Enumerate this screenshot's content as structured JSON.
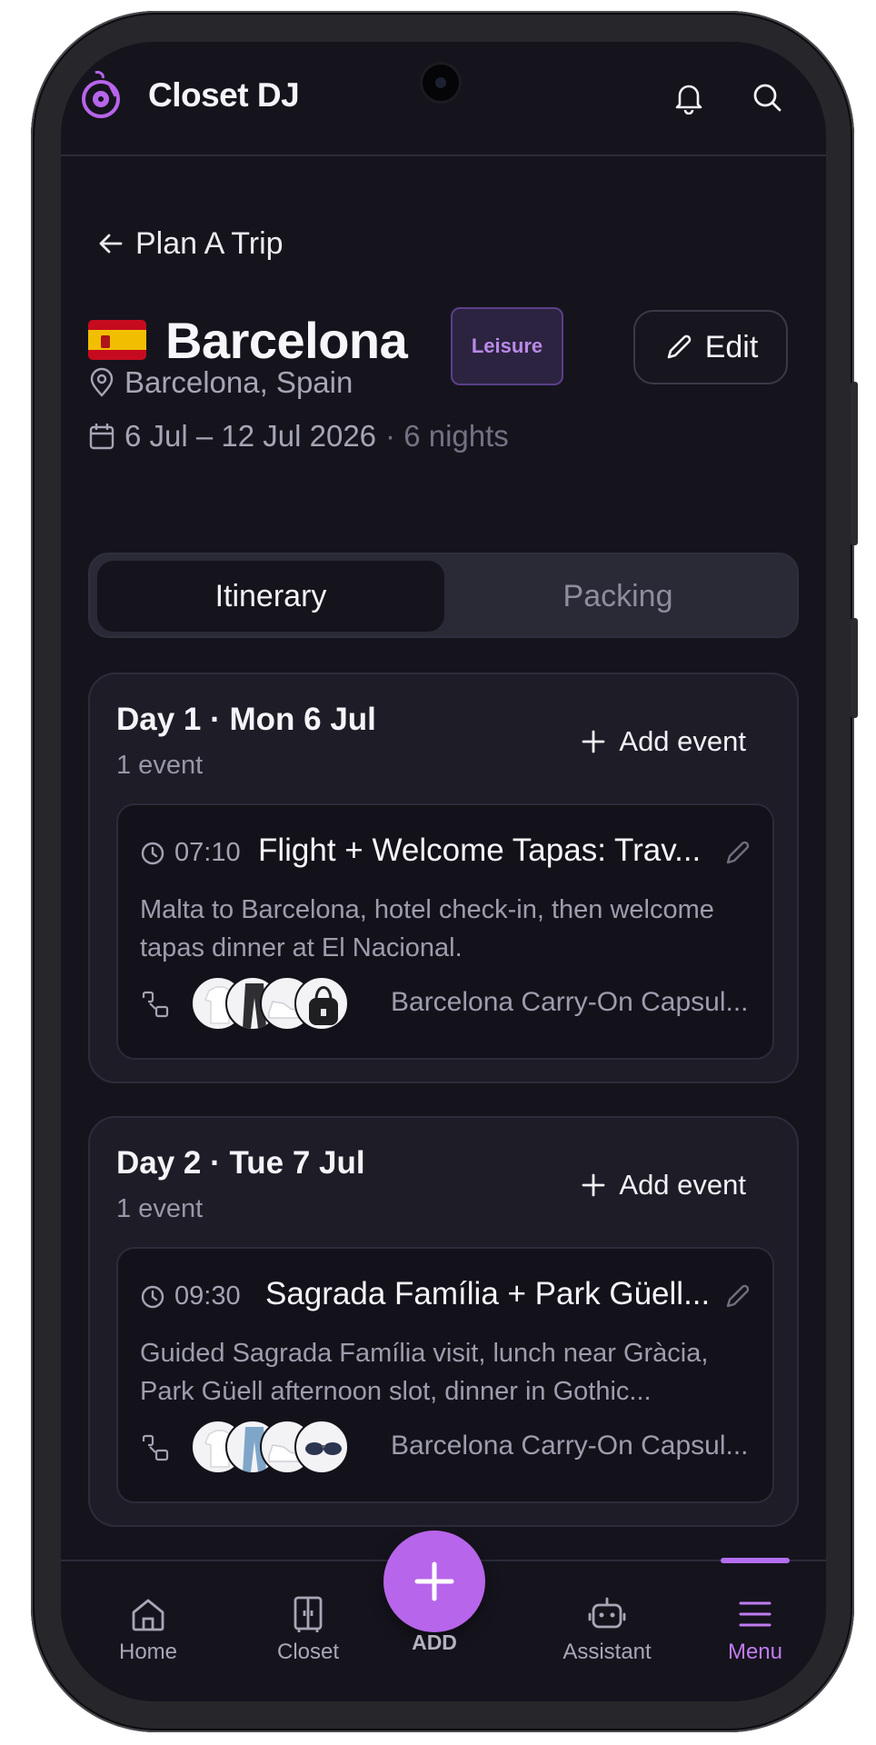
{
  "app": {
    "brand": "Closet DJ"
  },
  "back": {
    "label": "Plan A Trip"
  },
  "trip": {
    "title": "Barcelona",
    "badge": "Leisure",
    "edit_label": "Edit",
    "location": "Barcelona, Spain",
    "dates": "6 Jul – 12 Jul 2026",
    "nights": "· 6 nights"
  },
  "tabs": [
    {
      "label": "Itinerary",
      "active": true
    },
    {
      "label": "Packing",
      "active": false
    }
  ],
  "days": [
    {
      "title": "Day 1 · Mon 6 Jul",
      "count": "1 event",
      "add_label": "Add event",
      "event": {
        "time": "07:10",
        "title": "Flight + Welcome Tapas: Trav...",
        "description": "Malta to Barcelona, hotel check-in, then welcome tapas dinner at El Nacional.",
        "outfit": "Barcelona Carry-On Capsul..."
      }
    },
    {
      "title": "Day 2 · Tue 7 Jul",
      "count": "1 event",
      "add_label": "Add event",
      "event": {
        "time": "09:30",
        "title": "Sagrada Família + Park Güell...",
        "description": "Guided Sagrada Família visit, lunch near Gràcia, Park Güell afternoon slot, dinner in Gothic...",
        "outfit": "Barcelona Carry-On Capsul..."
      }
    }
  ],
  "nav": {
    "home": "Home",
    "closet": "Closet",
    "add": "ADD",
    "assistant": "Assistant",
    "menu": "Menu",
    "active": "menu"
  },
  "colors": {
    "accent": "#b765ea",
    "background": "#15141d",
    "card": "#1d1c27"
  }
}
